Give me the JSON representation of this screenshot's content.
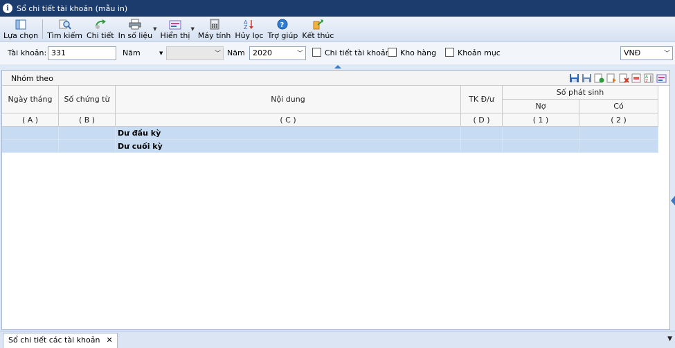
{
  "window": {
    "title": "Sổ chi tiết tài khoản (mẫu in)"
  },
  "toolbar": {
    "select_label": "Lựa chọn",
    "search_label": "Tìm kiếm",
    "detail_label": "Chi tiết",
    "print_label": "In số liệu",
    "display_label": "Hiển thị",
    "calc_label": "Máy tính",
    "unfilter_label": "Hủy lọc",
    "help_label": "Trợ giúp",
    "exit_label": "Kết thúc"
  },
  "filter": {
    "account_label": "Tài khoản:",
    "account_value": "331",
    "year_label_1": "Năm",
    "year_label_2": "Năm",
    "year_value": "2020",
    "detail_account_label": "Chi tiết tài khoản",
    "warehouse_label": "Kho hàng",
    "item_label": "Khoản mục",
    "currency_value": "VNĐ"
  },
  "group": {
    "label": "Nhóm theo"
  },
  "table": {
    "headers": {
      "date": "Ngày tháng",
      "voucher": "Số chứng từ",
      "content": "Nội dung",
      "account": "TK Đ/ư",
      "amount": "Số phát sinh",
      "debit": "Nợ",
      "credit": "Có"
    },
    "codes": [
      "( A )",
      "( B )",
      "( C )",
      "( D )",
      "( 1 )",
      "( 2 )"
    ],
    "rows": [
      {
        "content": "Dư đầu kỳ"
      },
      {
        "content": "Dư cuối kỳ"
      }
    ]
  },
  "status": {
    "tab_label": "Sổ chi tiết các tài khoản",
    "close_glyph": "✕"
  },
  "colors": {
    "title_bg": "#1c3c6e",
    "row_highlight": "#c7dcf2"
  }
}
